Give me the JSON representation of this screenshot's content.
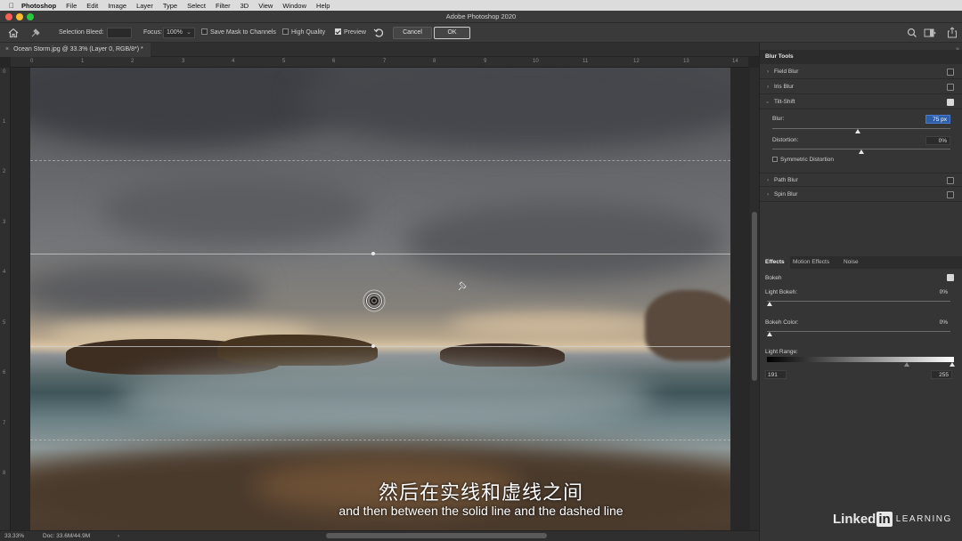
{
  "menubar": {
    "app": "Photoshop",
    "items": [
      "File",
      "Edit",
      "Image",
      "Layer",
      "Type",
      "Select",
      "Filter",
      "3D",
      "View",
      "Window",
      "Help"
    ]
  },
  "window": {
    "title": "Adobe Photoshop 2020"
  },
  "options": {
    "selection_bleed_label": "Selection Bleed:",
    "focus_label": "Focus:",
    "focus_value": "100%",
    "save_mask_label": "Save Mask to Channels",
    "high_quality_label": "High Quality",
    "preview_label": "Preview",
    "cancel_label": "Cancel",
    "ok_label": "OK"
  },
  "document": {
    "tab_title": "Ocean Storm.jpg @ 33.3% (Layer 0, RGB/8*) *"
  },
  "rulers": {
    "h": [
      "0",
      "1",
      "2",
      "3",
      "4",
      "5",
      "6",
      "7",
      "8",
      "9",
      "10",
      "11",
      "12",
      "13",
      "14"
    ],
    "v": [
      "0",
      "1",
      "2",
      "3",
      "4",
      "5",
      "6",
      "7",
      "8"
    ]
  },
  "status": {
    "zoom": "33.33%",
    "doc": "Doc: 33.6M/44.9M"
  },
  "blur_tools": {
    "title": "Blur Tools",
    "field_blur": "Field Blur",
    "iris_blur": "Iris Blur",
    "tilt_shift": "Tilt-Shift",
    "blur_label": "Blur:",
    "blur_value": "75 px",
    "blur_level": 0.75,
    "distortion_label": "Distortion:",
    "distortion_value": "0%",
    "symmetric_label": "Symmetric Distortion",
    "path_blur": "Path Blur",
    "spin_blur": "Spin Blur"
  },
  "effects": {
    "tabs": [
      "Effects",
      "Motion Effects",
      "Noise"
    ],
    "bokeh_label": "Bokeh",
    "light_bokeh_label": "Light Bokeh:",
    "light_bokeh_value": "0%",
    "bokeh_color_label": "Bokeh Color:",
    "bokeh_color_value": "0%",
    "light_range_label": "Light Range:",
    "light_range_low": "191",
    "light_range_high": "255"
  },
  "subtitles": {
    "cn": "然后在实线和虚线之间",
    "en": "and then between the solid line and the dashed line"
  },
  "brand": {
    "linked": "Linked",
    "in": "in",
    "learning": "LEARNING"
  },
  "colors": {
    "panel": "#353535",
    "menubar": "#dcdcdc",
    "close": "#fc5f57",
    "minimize": "#fdbc2e",
    "zoom": "#28c840"
  }
}
